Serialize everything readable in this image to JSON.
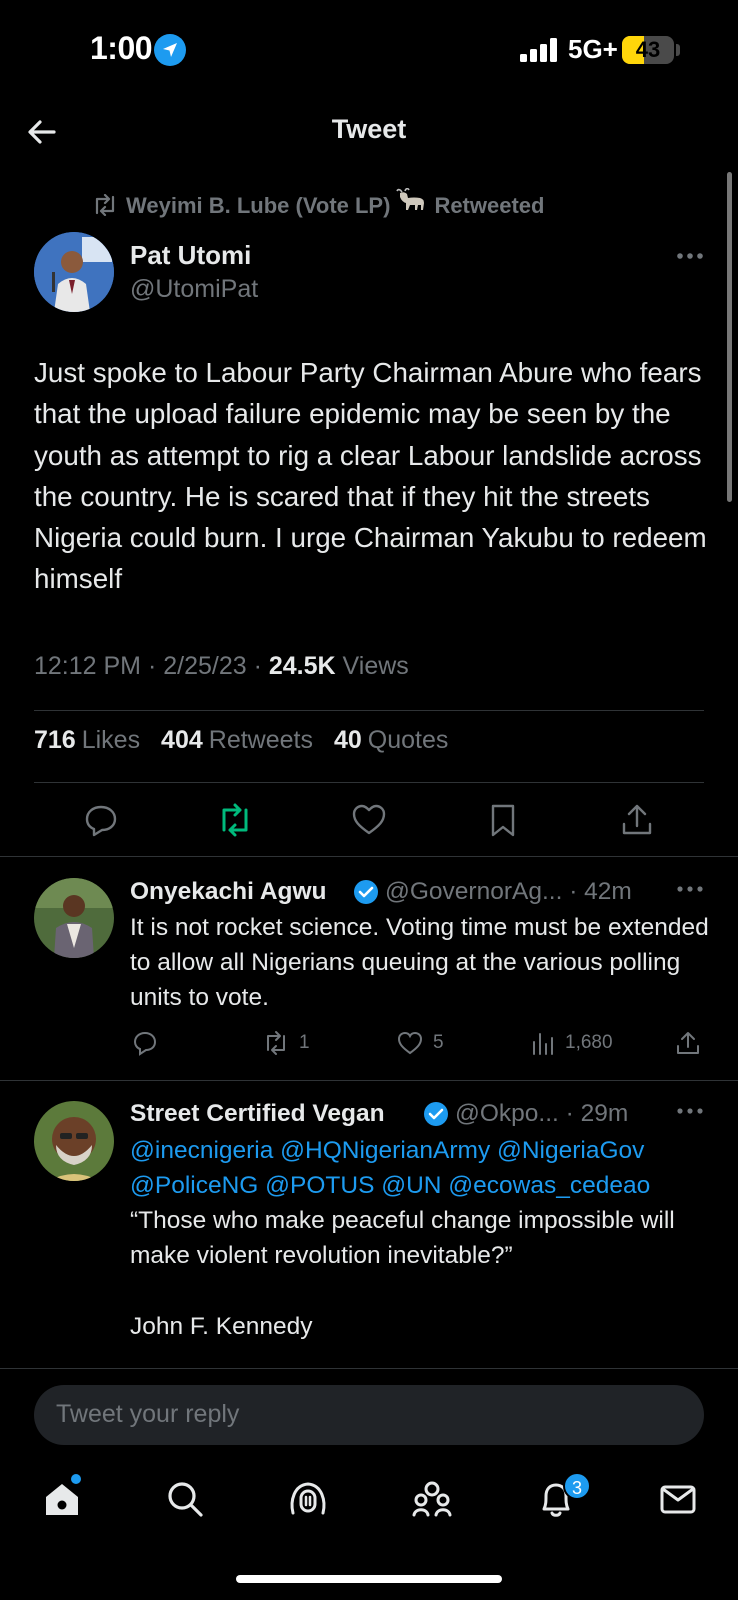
{
  "status_bar": {
    "time": "1:00",
    "network": "5G+",
    "battery": "43",
    "battery_level": 0.43
  },
  "header": {
    "title": "Tweet"
  },
  "retweet_banner": {
    "prefix": "Weyimi B. Lube (Vote LP)",
    "suffix": "Retweeted"
  },
  "main_tweet": {
    "author_name": "Pat Utomi",
    "author_handle": "@UtomiPat",
    "text": "Just spoke to Labour Party Chairman Abure who fears that the upload failure epidemic may be seen by the youth as attempt to rig a clear Labour landslide across the country. He is scared that if they hit the streets Nigeria could burn. I urge Chairman Yakubu to redeem himself",
    "time": "12:12 PM",
    "date": "2/25/23",
    "views_count": "24.5K",
    "views_label": "Views",
    "likes_count": "716",
    "likes_label": "Likes",
    "retweets_count": "404",
    "retweets_label": "Retweets",
    "quotes_count": "40",
    "quotes_label": "Quotes"
  },
  "replies": [
    {
      "name": "Onyekachi Agwu",
      "handle": "@GovernorAg...",
      "time": "42m",
      "text": "It is not rocket science. Voting time must be extended to allow all Nigerians queuing at the various polling units to vote.",
      "retweets": "1",
      "likes": "5",
      "views": "1,680"
    },
    {
      "name": "Street Certified Vegan",
      "handle": "@Okpo...",
      "time": "29m",
      "mentions_line1": "@inecnigeria @HQNigerianArmy @NigeriaGov",
      "mentions_line2": "@PoliceNG @POTUS @UN  @ecowas_cedeao",
      "quote": "“Those who make peaceful change impossible will make violent revolution inevitable?”",
      "attribution": "John F. Kennedy"
    }
  ],
  "reply_input": {
    "placeholder": "Tweet your reply"
  },
  "tabs": {
    "notifications_badge": "3"
  },
  "colors": {
    "accent": "#1d9bf0",
    "retweet_green": "#00ba7c",
    "muted": "#71767b"
  }
}
